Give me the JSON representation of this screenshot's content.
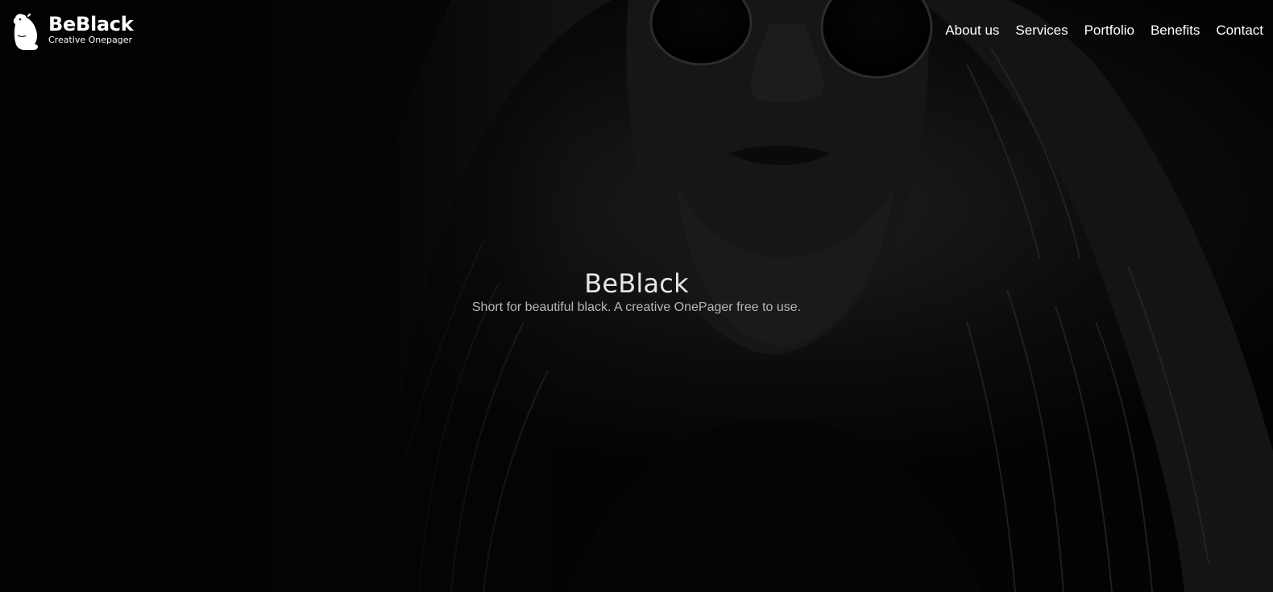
{
  "brand": {
    "name": "BeBlack",
    "tagline": "Creative Onepager",
    "logo_icon": "beaver-icon"
  },
  "nav": {
    "items": [
      {
        "label": "About us"
      },
      {
        "label": "Services"
      },
      {
        "label": "Portfolio"
      },
      {
        "label": "Benefits"
      },
      {
        "label": "Contact"
      }
    ]
  },
  "hero": {
    "title": "BeBlack",
    "subtitle": "Short for beautiful black. A creative OnePager free to use.",
    "background": "dark monochrome portrait of a long-haired bearded man wearing round sunglasses"
  },
  "colors": {
    "background": "#000000",
    "text": "#ffffff",
    "subtitle": "#b8b8b8"
  }
}
